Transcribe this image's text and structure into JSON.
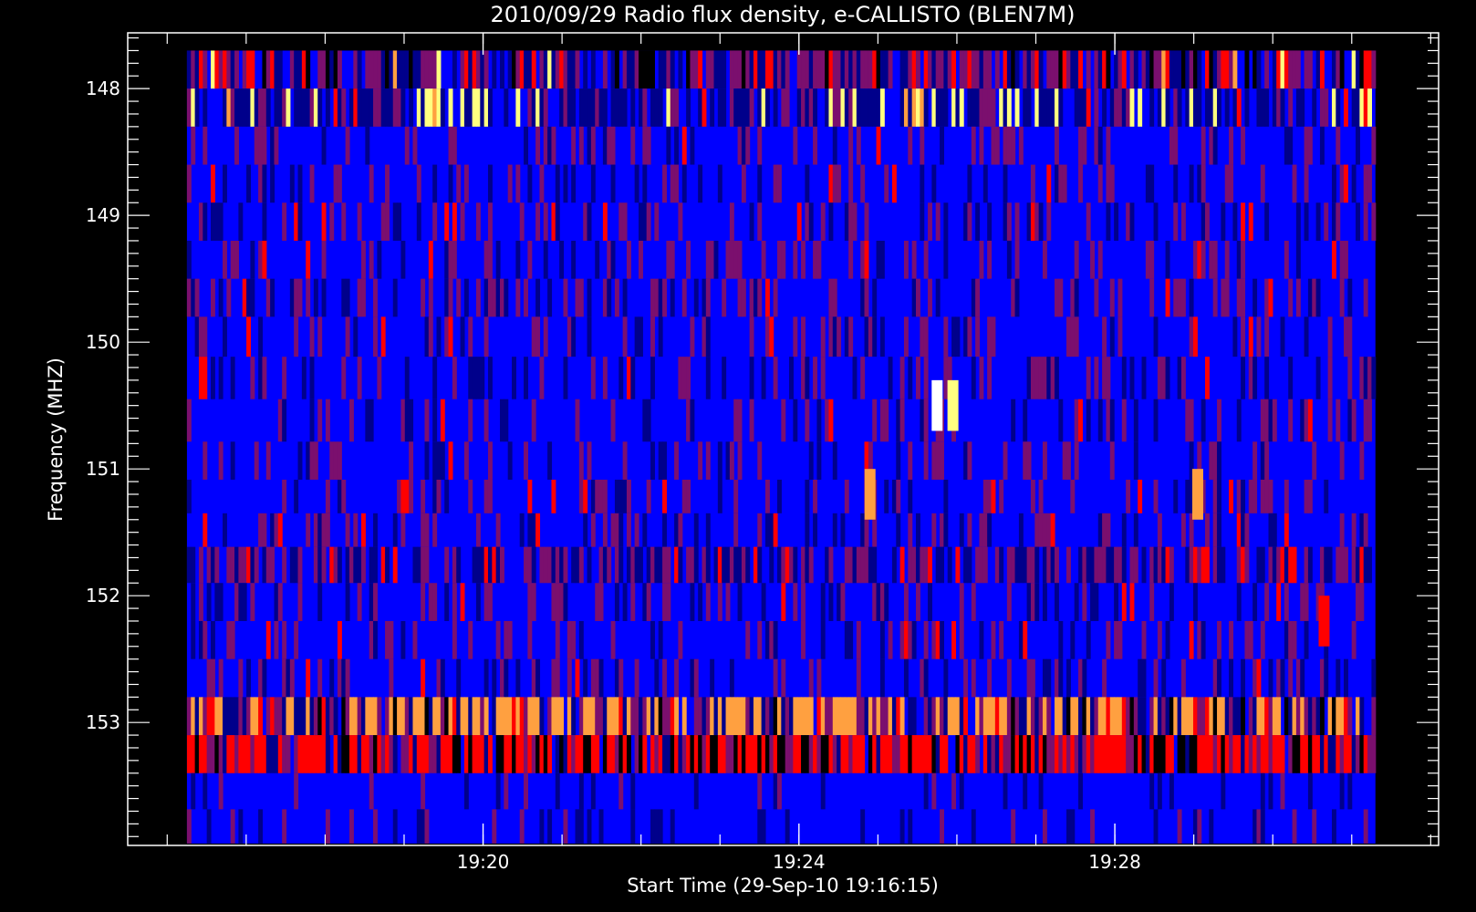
{
  "chart_data": {
    "type": "heatmap",
    "title": "2010/09/29  Radio flux density, e-CALLISTO (BLEN7M)",
    "xlabel": "Start Time (29-Sep-10 19:16:15)",
    "ylabel": "Frequency (MHZ)",
    "x_unit": "minutes after 19:16:15",
    "xlim": [
      -0.75,
      15.85
    ],
    "data_x_range": [
      0,
      15.05
    ],
    "x_ticks": [
      {
        "label": "19:20",
        "value": 3.75
      },
      {
        "label": "19:24",
        "value": 7.75
      },
      {
        "label": "19:28",
        "value": 11.75
      }
    ],
    "y_unit": "MHz",
    "ylim": [
      147.56,
      153.97
    ],
    "y_reversed": true,
    "y_ticks": [
      148,
      149,
      150,
      151,
      152,
      153
    ],
    "frequency_channels_mhz": [
      147.85,
      148.15,
      148.45,
      148.75,
      149.05,
      149.35,
      149.65,
      149.95,
      150.28,
      150.62,
      150.95,
      151.22,
      151.48,
      151.75,
      152.05,
      152.35,
      152.65,
      152.95,
      153.25,
      153.55,
      153.82
    ],
    "colormap": [
      "#000000",
      "#00008b",
      "#0000ff",
      "#7b0f6e",
      "#ff0000",
      "#ffa040",
      "#ffff80",
      "#ffffff"
    ],
    "grid": false,
    "legend": "none",
    "description_free_bursts": [
      {
        "time_min": 9.5,
        "freq_mhz": 150.5,
        "level": "white"
      },
      {
        "time_min": 9.7,
        "freq_mhz": 150.5,
        "level": "light-yellow"
      },
      {
        "time_min": 8.65,
        "freq_mhz": 151.2,
        "level": "orange"
      },
      {
        "time_min": 12.8,
        "freq_mhz": 151.2,
        "level": "orange"
      },
      {
        "time_min": 14.4,
        "freq_mhz": 152.2,
        "level": "red"
      }
    ]
  }
}
